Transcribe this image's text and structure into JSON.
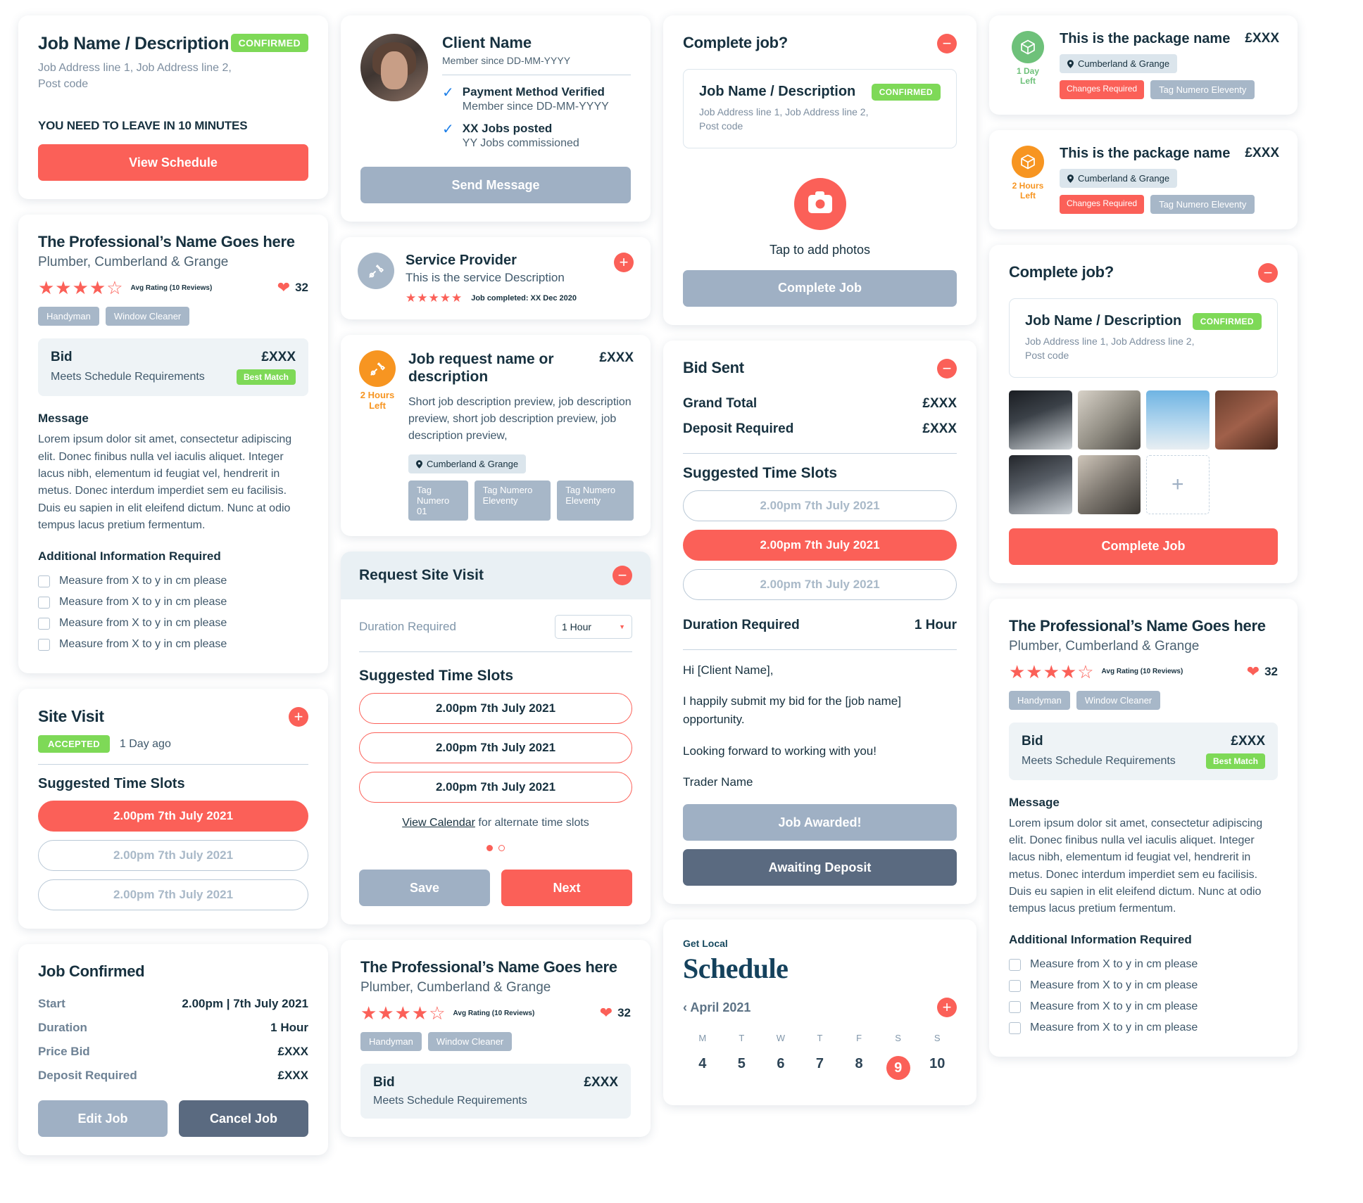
{
  "job_card": {
    "title": "Job Name / Description",
    "status": "CONFIRMED",
    "address_line1": "Job Address line 1, Job Address line 2,",
    "address_line2": "Post code",
    "leave_note": "YOU NEED TO LEAVE IN 10 MINUTES",
    "cta": "View Schedule"
  },
  "professional": {
    "name": "The Professional’s Name Goes here",
    "subtitle": "Plumber, Cumberland & Grange",
    "stars": "★★★★",
    "half_star": "☆",
    "rating_text": "Avg Rating (10 Reviews)",
    "likes": "32",
    "chips": [
      "Handyman",
      "Window Cleaner"
    ],
    "bid_label": "Bid",
    "bid_price": "£XXX",
    "bid_meets": "Meets Schedule Requirements",
    "best_match": "Best Match",
    "message_heading": "Message",
    "message_body": "Lorem ipsum dolor sit amet, consectetur adipiscing elit. Donec finibus nulla vel iaculis aliquet. Integer lacus nibh, elementum id feugiat vel, hendrerit in metus. Donec interdum imperdiet sem eu facilisis. Duis eu sapien in elit eleifend dictum. Nunc at odio tempus lacus pretium fermentum.",
    "additional_heading": "Additional Information Required",
    "checklist": [
      "Measure from X to y in cm please",
      "Measure from X to y in cm please",
      "Measure from X to y in cm please",
      "Measure from X to y in cm please"
    ]
  },
  "site_visit": {
    "title": "Site Visit",
    "status": "ACCEPTED",
    "ago": "1 Day ago",
    "slots_heading": "Suggested Time Slots",
    "slots": [
      "2.00pm 7th July 2021",
      "2.00pm 7th July 2021",
      "2.00pm 7th July 2021"
    ],
    "selected_index": 0
  },
  "job_confirmed": {
    "title": "Job Confirmed",
    "rows": [
      {
        "key": "Start",
        "value": "2.00pm  |  7th July 2021"
      },
      {
        "key": "Duration",
        "value": "1 Hour"
      },
      {
        "key": "Price Bid",
        "value": "£XXX"
      },
      {
        "key": "Deposit Required",
        "value": "£XXX"
      }
    ],
    "edit_label": "Edit Job",
    "cancel_label": "Cancel Job"
  },
  "client": {
    "name": "Client Name",
    "member_since": "Member since DD-MM-YYYY",
    "verifications": [
      {
        "main": "Payment Method Verified",
        "sub": "Member since DD-MM-YYYY"
      },
      {
        "main": "XX Jobs posted",
        "sub": "YY Jobs commissioned"
      }
    ],
    "send_message": "Send Message"
  },
  "service_provider": {
    "title": "Service Provider",
    "description": "This is the service Description",
    "stars": "★★★★★",
    "meta": "Job completed: XX Dec 2020"
  },
  "job_request": {
    "timer": "2 Hours\nLeft",
    "title": "Job request name or description",
    "price": "£XXX",
    "description": "Short job description preview, job description preview, short job description preview, job description preview,",
    "location": "Cumberland & Grange",
    "tags": [
      "Tag Numero 01",
      "Tag Numero  Eleventy",
      "Tag Numero  Eleventy"
    ]
  },
  "request_site_visit": {
    "title": "Request Site Visit",
    "duration_label": "Duration Required",
    "duration_value": "1 Hour",
    "slots_heading": "Suggested Time Slots",
    "slots": [
      "2.00pm 7th July 2021",
      "2.00pm 7th July 2021",
      "2.00pm 7th July 2021"
    ],
    "calendar_link": "View Calendar",
    "calendar_rest": " for alternate time slots",
    "save_label": "Save",
    "next_label": "Next"
  },
  "pro_card_bottom": {
    "name": "The Professional’s Name Goes here",
    "subtitle": "Plumber, Cumberland & Grange",
    "rating_text": "Avg Rating (10 Reviews)",
    "likes": "32",
    "chips": [
      "Handyman",
      "Window Cleaner"
    ],
    "bid_label": "Bid",
    "bid_price": "£XXX",
    "bid_meets": "Meets Schedule Requirements"
  },
  "complete_job_photos": {
    "title": "Complete job?",
    "job_title": "Job Name / Description",
    "status": "CONFIRMED",
    "address_line1": "Job Address line 1, Job Address line 2,",
    "address_line2": "Post code",
    "tap_text": "Tap to add photos",
    "cta": "Complete Job"
  },
  "bid_sent": {
    "title": "Bid Sent",
    "grand_total_label": "Grand Total",
    "grand_total_value": "£XXX",
    "deposit_label": "Deposit Required",
    "deposit_value": "£XXX",
    "slots_heading": "Suggested Time Slots",
    "slots": [
      "2.00pm 7th July 2021",
      "2.00pm 7th July 2021",
      "2.00pm 7th July 2021"
    ],
    "selected_index": 1,
    "duration_label": "Duration Required",
    "duration_value": "1 Hour",
    "message_lines": [
      "Hi [Client Name],",
      "I happily submit my bid for the [job name] opportunity.",
      "Looking forward to working with you!",
      "Trader Name"
    ],
    "awarded_label": "Job Awarded!",
    "awaiting_label": "Awaiting Deposit"
  },
  "schedule": {
    "kicker": "Get Local",
    "title": "Schedule",
    "month": "‹ April 2021",
    "dow": [
      "M",
      "T",
      "W",
      "T",
      "F",
      "S",
      "S"
    ],
    "days": [
      "4",
      "5",
      "6",
      "7",
      "8",
      "9",
      "10"
    ],
    "selected_index": 5
  },
  "packages": [
    {
      "timer": "1 Day\nLeft",
      "timer_color": "green",
      "name": "This is the package name",
      "price": "£XXX",
      "location": "Cumberland & Grange",
      "warn": "Changes Required",
      "tag": "Tag Numero  Eleventy"
    },
    {
      "timer": "2 Hours\nLeft",
      "timer_color": "orange",
      "name": "This is the package name",
      "price": "£XXX",
      "location": "Cumberland & Grange",
      "warn": "Changes Required",
      "tag": "Tag Numero  Eleventy"
    }
  ],
  "complete_job_gallery": {
    "title": "Complete job?",
    "job_title": "Job Name / Description",
    "status": "CONFIRMED",
    "address_line1": "Job Address line 1, Job Address line 2,",
    "address_line2": "Post code",
    "cta": "Complete Job"
  },
  "colors": {
    "accent_red": "#fb6058",
    "green": "#7ed957",
    "orange": "#f79521",
    "blue_grey": "#9fb0c4",
    "dark": "#17313f"
  }
}
